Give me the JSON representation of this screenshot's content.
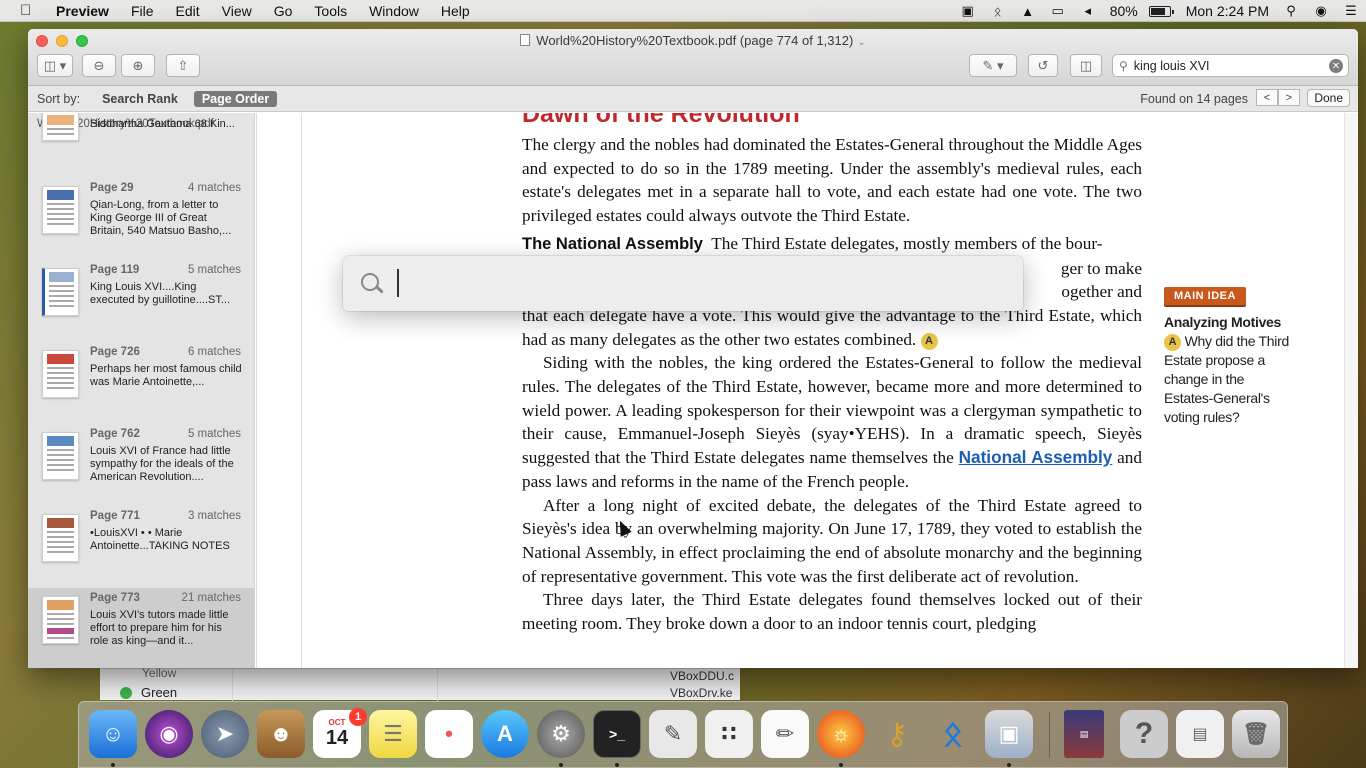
{
  "menubar": {
    "apple_icon": "apple-icon",
    "app_name": "Preview",
    "menus": [
      "File",
      "Edit",
      "View",
      "Go",
      "Tools",
      "Window",
      "Help"
    ],
    "battery_percent": "80%",
    "battery_level": 0.8,
    "clock": "Mon 2:24 PM"
  },
  "window": {
    "title": "World%20History%20Textbook.pdf (page 774 of 1,312)",
    "search_value": "king louis XVI"
  },
  "findbar": {
    "sort_label": "Sort by:",
    "options": [
      "Search Rank",
      "Page Order"
    ],
    "active_option": "Page Order",
    "found_text": "Found on 14 pages",
    "prev_label": "<",
    "next_label": ">",
    "done_label": "Done"
  },
  "sidebar": {
    "file_name": "World%20History%20Textbook.pdf",
    "results": [
      {
        "page": "",
        "matches": "",
        "text": "Siddhartha Gautama 68 Kin..."
      },
      {
        "page": "Page 29",
        "matches": "4 matches",
        "text": "Qian-Long, from a letter to King George III of Great Britain, 540 Matsuo Basho,..."
      },
      {
        "page": "Page 119",
        "matches": "5 matches",
        "text": "King Louis XVI....King executed by guillotine....ST..."
      },
      {
        "page": "Page 726",
        "matches": "6 matches",
        "text": "Perhaps her most famous child was Marie Antoinette,..."
      },
      {
        "page": "Page 762",
        "matches": "5 matches",
        "text": "Louis XVI of France had little sympathy for the ideals of the American Revolution...."
      },
      {
        "page": "Page 771",
        "matches": "3 matches",
        "text": "•LouisXVI • • Marie Antoinette...TAKING NOTES"
      },
      {
        "page": "Page 773",
        "matches": "21 matches",
        "text": "Louis XVI's tutors made little effort to prepare him for his role as king—and it..."
      }
    ]
  },
  "document": {
    "heading": "Dawn of the Revolution",
    "para1": "The clergy and the nobles had dominated the Estates-General throughout the Middle Ages and expected to do so in the 1789 meeting. Under the assembly's medieval rules, each estate's delegates met in a separate hall to vote, and each estate had one vote. The two privileged estates could always outvote the Third Estate.",
    "subheading": "The National Assembly",
    "para2_start": "The Third Estate delegates, mostly members of the bour-",
    "para2_frag1": "ger to make",
    "para2_frag2": "ogether and",
    "para2_rest": "that each delegate have a vote. This would give the advantage to the Third Estate, which had as many delegates as the other two estates combined.",
    "marker": "A",
    "para3_a": "Siding with the nobles, the king ordered the Estates-General to follow the medieval rules. The delegates of the Third Estate, however, became more and more determined to wield power. A leading spokesperson for their viewpoint was a clergyman sympathetic to their cause, Emmanuel-Joseph Sieyès (syay•YEHS). In a dramatic speech, Sieyès suggested that the Third Estate delegates name themselves the ",
    "link": "National Assembly",
    "para3_b": " and pass laws and reforms in the name of the French people.",
    "para4": "After a long night of excited debate, the delegates of the Third Estate agreed to Sieyès's idea by an overwhelming majority. On June 17, 1789, they voted to establish the National Assembly, in effect proclaiming the end of absolute monarchy and the beginning of representative government. This vote was the first deliberate act of revolution.",
    "para5": "Three days later, the Third Estate delegates found themselves locked out of their meeting room. They broke down a door to an indoor tennis court, pledging",
    "margin": {
      "tag": "MAIN IDEA",
      "title": "Analyzing Motives",
      "marker": "A",
      "question": "Why did the Third Estate propose a change in the Estates-General's voting rules?"
    }
  },
  "spotlight": {
    "value": "",
    "icon": "search-icon"
  },
  "background_window": {
    "label_yellow": "Yellow",
    "label_green": "Green",
    "files": [
      "VBoxDDU.c",
      "VBoxDrv.ke"
    ]
  },
  "dock": {
    "items": [
      "Finder",
      "Siri",
      "Launchpad",
      "Contacts",
      "Calendar",
      "Notes",
      "Reminders",
      "App Store",
      "System Preferences",
      "Terminal",
      "Script Editor",
      "Instruments",
      "TextEdit",
      "Firefox",
      "Keychain Access",
      "Bluetooth File Exchange",
      "Preview",
      "World History",
      "Help",
      "Documents",
      "Trash"
    ],
    "calendar_month": "OCT",
    "calendar_day": "14",
    "calendar_badge": "1"
  }
}
